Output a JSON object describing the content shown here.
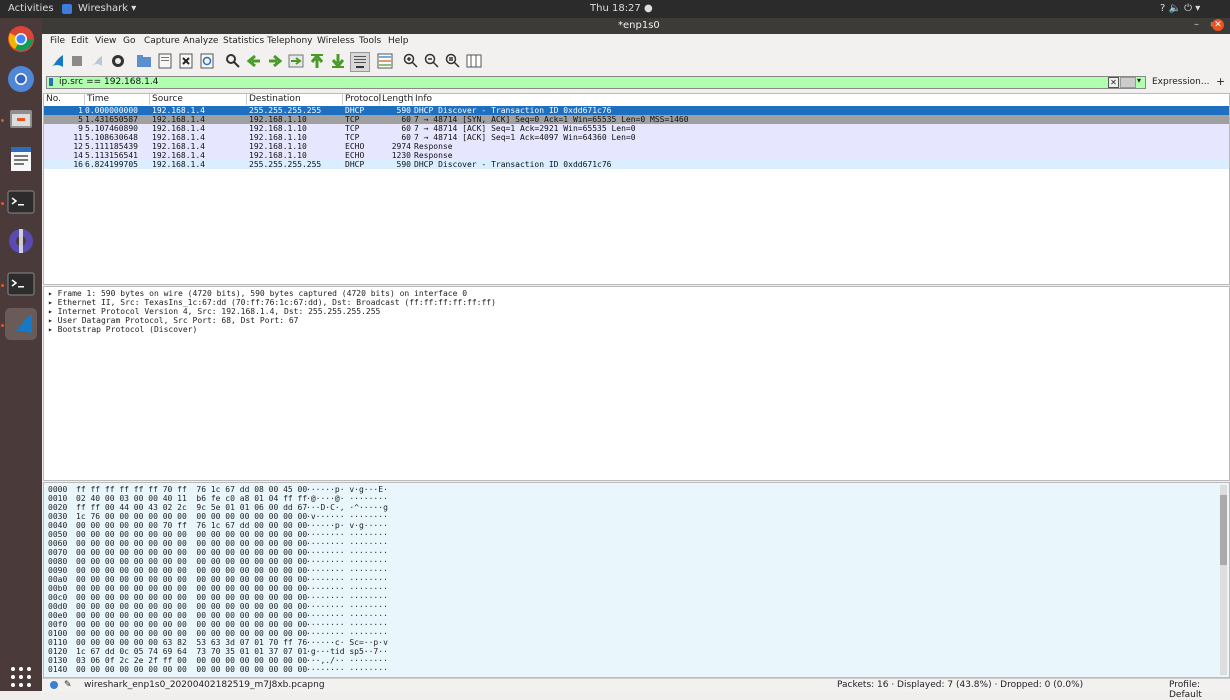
{
  "topbar": {
    "activities": "Activities",
    "app_name": "Wireshark ▾",
    "clock": "Thu 18:27 ●",
    "sys_icons": "? 🔈 ⏻ ▾"
  },
  "window": {
    "title": "*enp1s0"
  },
  "menu": [
    "File",
    "Edit",
    "View",
    "Go",
    "Capture",
    "Analyze",
    "Statistics",
    "Telephony",
    "Wireless",
    "Tools",
    "Help"
  ],
  "filter": {
    "value": "ip.src == 192.168.1.4",
    "expression_label": "Expression...",
    "plus": "+"
  },
  "columns": [
    "No.",
    "Time",
    "Source",
    "Destination",
    "Protocol",
    "Length",
    "Info"
  ],
  "packets": [
    {
      "no": "1",
      "time": "0.000000000",
      "src": "192.168.1.4",
      "dst": "255.255.255.255",
      "proto": "DHCP",
      "len": "590",
      "info": "DHCP Discover - Transaction ID 0xdd671c76",
      "style": "selected"
    },
    {
      "no": "5",
      "time": "1.431650587",
      "src": "192.168.1.4",
      "dst": "192.168.1.10",
      "proto": "TCP",
      "len": "60",
      "info": "7 → 48714 [SYN, ACK] Seq=0 Ack=1 Win=65535 Len=0 MSS=1460",
      "style": "gray"
    },
    {
      "no": "9",
      "time": "5.107460890",
      "src": "192.168.1.4",
      "dst": "192.168.1.10",
      "proto": "TCP",
      "len": "60",
      "info": "7 → 48714 [ACK] Seq=1 Ack=2921 Win=65535 Len=0",
      "style": "tcp"
    },
    {
      "no": "11",
      "time": "5.108630648",
      "src": "192.168.1.4",
      "dst": "192.168.1.10",
      "proto": "TCP",
      "len": "60",
      "info": "7 → 48714 [ACK] Seq=1 Ack=4097 Win=64360 Len=0",
      "style": "tcp"
    },
    {
      "no": "12",
      "time": "5.111185439",
      "src": "192.168.1.4",
      "dst": "192.168.1.10",
      "proto": "ECHO",
      "len": "2974",
      "info": "Response",
      "style": "tcp"
    },
    {
      "no": "14",
      "time": "5.113156541",
      "src": "192.168.1.4",
      "dst": "192.168.1.10",
      "proto": "ECHO",
      "len": "1230",
      "info": "Response",
      "style": "tcp"
    },
    {
      "no": "16",
      "time": "6.824199705",
      "src": "192.168.1.4",
      "dst": "255.255.255.255",
      "proto": "DHCP",
      "len": "590",
      "info": "DHCP Discover - Transaction ID 0xdd671c76",
      "style": "udp"
    }
  ],
  "details": [
    "Frame 1: 590 bytes on wire (4720 bits), 590 bytes captured (4720 bits) on interface 0",
    "Ethernet II, Src: TexasIns_1c:67:dd (70:ff:76:1c:67:dd), Dst: Broadcast (ff:ff:ff:ff:ff:ff)",
    "Internet Protocol Version 4, Src: 192.168.1.4, Dst: 255.255.255.255",
    "User Datagram Protocol, Src Port: 68, Dst Port: 67",
    "Bootstrap Protocol (Discover)"
  ],
  "bytes": [
    {
      "off": "0000",
      "hex": "ff ff ff ff ff ff 70 ff  76 1c 67 dd 08 00 45 00",
      "ascii": "······p· v·g···E·"
    },
    {
      "off": "0010",
      "hex": "02 40 00 03 00 00 40 11  b6 fe c0 a8 01 04 ff ff",
      "ascii": "·@····@· ········"
    },
    {
      "off": "0020",
      "hex": "ff ff 00 44 00 43 02 2c  9c 5e 01 01 06 00 dd 67",
      "ascii": "···D·C·, ·^·····g"
    },
    {
      "off": "0030",
      "hex": "1c 76 00 00 00 00 00 00  00 00 00 00 00 00 00 00",
      "ascii": "·v······ ········"
    },
    {
      "off": "0040",
      "hex": "00 00 00 00 00 00 70 ff  76 1c 67 dd 00 00 00 00",
      "ascii": "······p· v·g·····"
    },
    {
      "off": "0050",
      "hex": "00 00 00 00 00 00 00 00  00 00 00 00 00 00 00 00",
      "ascii": "········ ········"
    },
    {
      "off": "0060",
      "hex": "00 00 00 00 00 00 00 00  00 00 00 00 00 00 00 00",
      "ascii": "········ ········"
    },
    {
      "off": "0070",
      "hex": "00 00 00 00 00 00 00 00  00 00 00 00 00 00 00 00",
      "ascii": "········ ········"
    },
    {
      "off": "0080",
      "hex": "00 00 00 00 00 00 00 00  00 00 00 00 00 00 00 00",
      "ascii": "········ ········"
    },
    {
      "off": "0090",
      "hex": "00 00 00 00 00 00 00 00  00 00 00 00 00 00 00 00",
      "ascii": "········ ········"
    },
    {
      "off": "00a0",
      "hex": "00 00 00 00 00 00 00 00  00 00 00 00 00 00 00 00",
      "ascii": "········ ········"
    },
    {
      "off": "00b0",
      "hex": "00 00 00 00 00 00 00 00  00 00 00 00 00 00 00 00",
      "ascii": "········ ········"
    },
    {
      "off": "00c0",
      "hex": "00 00 00 00 00 00 00 00  00 00 00 00 00 00 00 00",
      "ascii": "········ ········"
    },
    {
      "off": "00d0",
      "hex": "00 00 00 00 00 00 00 00  00 00 00 00 00 00 00 00",
      "ascii": "········ ········"
    },
    {
      "off": "00e0",
      "hex": "00 00 00 00 00 00 00 00  00 00 00 00 00 00 00 00",
      "ascii": "········ ········"
    },
    {
      "off": "00f0",
      "hex": "00 00 00 00 00 00 00 00  00 00 00 00 00 00 00 00",
      "ascii": "········ ········"
    },
    {
      "off": "0100",
      "hex": "00 00 00 00 00 00 00 00  00 00 00 00 00 00 00 00",
      "ascii": "········ ········"
    },
    {
      "off": "0110",
      "hex": "00 00 00 00 00 00 63 82  53 63 3d 07 01 70 ff 76",
      "ascii": "······c· Sc=··p·v"
    },
    {
      "off": "0120",
      "hex": "1c 67 dd 0c 05 74 69 64  73 70 35 01 01 37 07 01",
      "ascii": "·g···tid sp5··7··"
    },
    {
      "off": "0130",
      "hex": "03 06 0f 2c 2e 2f ff 00  00 00 00 00 00 00 00 00",
      "ascii": "···,./·· ········"
    },
    {
      "off": "0140",
      "hex": "00 00 00 00 00 00 00 00  00 00 00 00 00 00 00 00",
      "ascii": "········ ········"
    }
  ],
  "status": {
    "file": "wireshark_enp1s0_20200402182519_m7J8xb.pcapng",
    "stats": "Packets: 16 · Displayed: 7 (43.8%) · Dropped: 0 (0.0%)",
    "profile": "Profile: Default"
  },
  "colors": {
    "selected": "#1e6fc0",
    "gray": "#a0a0a0",
    "tcp": "#e7e6ff",
    "udp": "#daeeff",
    "filter_ok": "#afffaf"
  }
}
